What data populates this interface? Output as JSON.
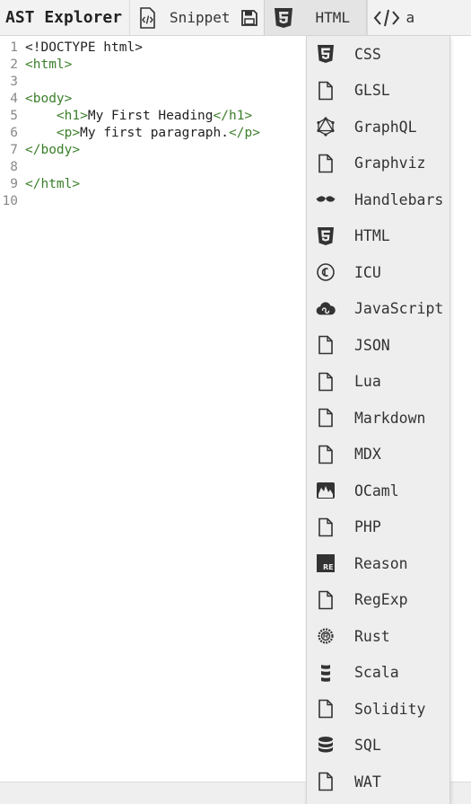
{
  "toolbar": {
    "brand": "AST Explorer",
    "snippet_label": "Snippet",
    "language_label": "HTML",
    "truncated_label": "a"
  },
  "editor": {
    "lines": [
      {
        "num": "1",
        "parts": [
          {
            "t": "<!DOCTYPE html>",
            "c": "code"
          }
        ]
      },
      {
        "num": "2",
        "parts": [
          {
            "t": "<html>",
            "c": "tag"
          }
        ]
      },
      {
        "num": "3",
        "parts": []
      },
      {
        "num": "4",
        "parts": [
          {
            "t": "<body>",
            "c": "tag"
          }
        ]
      },
      {
        "num": "5",
        "parts": [
          {
            "t": "    ",
            "c": "code"
          },
          {
            "t": "<h1>",
            "c": "tag"
          },
          {
            "t": "My First Heading",
            "c": "code"
          },
          {
            "t": "</h1>",
            "c": "tag"
          }
        ]
      },
      {
        "num": "6",
        "parts": [
          {
            "t": "    ",
            "c": "code"
          },
          {
            "t": "<p>",
            "c": "tag"
          },
          {
            "t": "My first paragraph.",
            "c": "code"
          },
          {
            "t": "</p>",
            "c": "tag"
          }
        ]
      },
      {
        "num": "7",
        "parts": [
          {
            "t": "</body>",
            "c": "tag"
          }
        ]
      },
      {
        "num": "8",
        "parts": []
      },
      {
        "num": "9",
        "parts": [
          {
            "t": "</html>",
            "c": "tag"
          }
        ]
      },
      {
        "num": "10",
        "parts": []
      }
    ]
  },
  "language_menu": {
    "items": [
      {
        "label": "CSS",
        "icon": "css3-icon"
      },
      {
        "label": "GLSL",
        "icon": "file-icon"
      },
      {
        "label": "GraphQL",
        "icon": "graphql-icon"
      },
      {
        "label": "Graphviz",
        "icon": "file-icon"
      },
      {
        "label": "Handlebars",
        "icon": "mustache-icon"
      },
      {
        "label": "HTML",
        "icon": "html5-icon"
      },
      {
        "label": "ICU",
        "icon": "icu-icon"
      },
      {
        "label": "JavaScript",
        "icon": "cloud-icon"
      },
      {
        "label": "JSON",
        "icon": "file-icon"
      },
      {
        "label": "Lua",
        "icon": "file-icon"
      },
      {
        "label": "Markdown",
        "icon": "file-icon"
      },
      {
        "label": "MDX",
        "icon": "file-icon"
      },
      {
        "label": "OCaml",
        "icon": "ocaml-icon"
      },
      {
        "label": "PHP",
        "icon": "file-icon"
      },
      {
        "label": "Reason",
        "icon": "reason-icon"
      },
      {
        "label": "RegExp",
        "icon": "file-icon"
      },
      {
        "label": "Rust",
        "icon": "rust-icon"
      },
      {
        "label": "Scala",
        "icon": "scala-icon"
      },
      {
        "label": "Solidity",
        "icon": "file-icon"
      },
      {
        "label": "SQL",
        "icon": "database-icon"
      },
      {
        "label": "WAT",
        "icon": "file-icon"
      }
    ]
  },
  "colors": {
    "tag": "#3a7f2a",
    "menu_bg": "#eeeeee",
    "toolbar_bg": "#f2f2f2"
  }
}
